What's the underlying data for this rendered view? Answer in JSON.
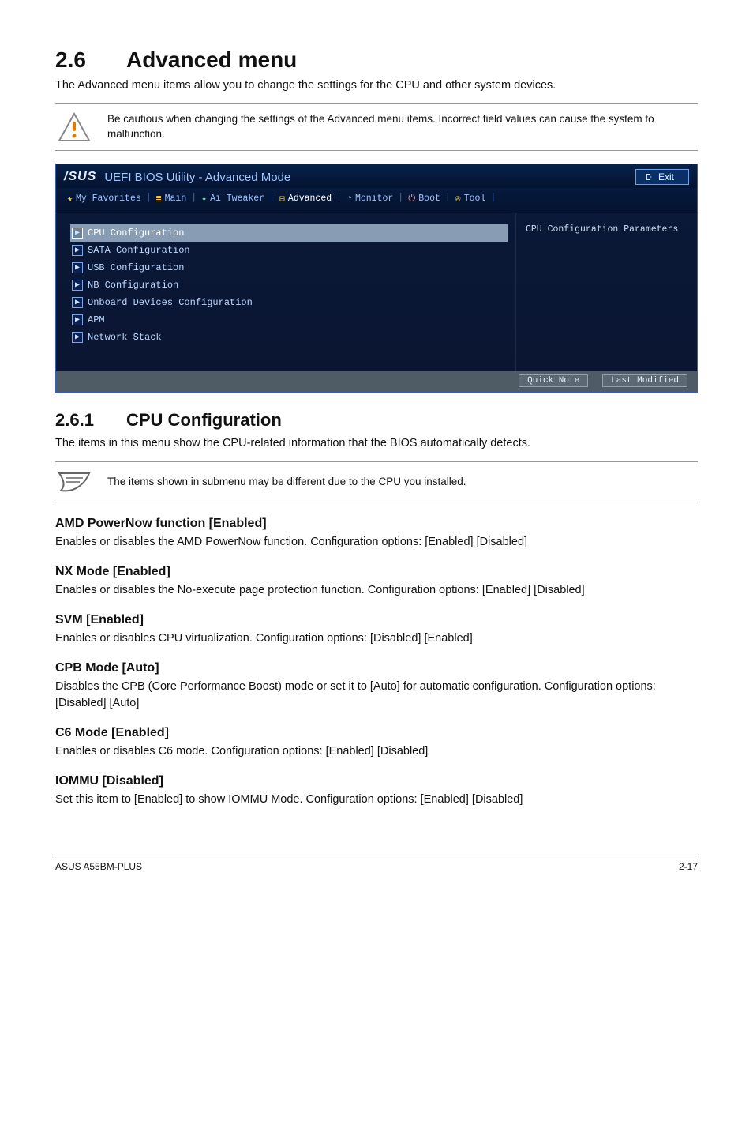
{
  "section": {
    "num": "2.6",
    "title": "Advanced menu",
    "intro": "The Advanced menu items allow you to change the settings for the CPU and other system devices."
  },
  "caution_note": "Be cautious when changing the settings of the Advanced menu items. Incorrect field values can cause the system to malfunction.",
  "bios": {
    "brand": "/SUS",
    "title": "UEFI BIOS Utility - Advanced Mode",
    "exit": "Exit",
    "tabs": {
      "fav": "My Favorites",
      "main": "Main",
      "tweaker": "Ai Tweaker",
      "advanced": "Advanced",
      "monitor": "Monitor",
      "boot": "Boot",
      "tool": "Tool"
    },
    "items": [
      "CPU Configuration",
      "SATA Configuration",
      "USB Configuration",
      "NB Configuration",
      "Onboard Devices Configuration",
      "APM",
      "Network Stack"
    ],
    "right_hint": "CPU Configuration Parameters",
    "footer": {
      "quick": "Quick Note",
      "last": "Last Modified"
    }
  },
  "subsection": {
    "num": "2.6.1",
    "title": "CPU Configuration",
    "intro": "The items in this menu show the CPU-related information that the BIOS automatically detects."
  },
  "info_note": "The items shown in submenu may be different due to the CPU you installed.",
  "settings": [
    {
      "heading": "AMD PowerNow function [Enabled]",
      "body": "Enables or disables the AMD PowerNow function. Configuration options: [Enabled] [Disabled]"
    },
    {
      "heading": "NX Mode [Enabled]",
      "body": "Enables or disables the No-execute page protection function. Configuration options: [Enabled] [Disabled]"
    },
    {
      "heading": "SVM [Enabled]",
      "body": "Enables or disables CPU virtualization. Configuration options: [Disabled] [Enabled]"
    },
    {
      "heading": "CPB Mode [Auto]",
      "body": "Disables the CPB (Core Performance Boost) mode or set it to [Auto] for automatic configuration. Configuration options: [Disabled] [Auto]"
    },
    {
      "heading": "C6 Mode [Enabled]",
      "body": "Enables or disables C6 mode. Configuration options: [Enabled] [Disabled]"
    },
    {
      "heading": "IOMMU [Disabled]",
      "body": "Set this item to [Enabled] to show IOMMU Mode. Configuration options: [Enabled] [Disabled]"
    }
  ],
  "footer": {
    "left": "ASUS A55BM-PLUS",
    "right": "2-17"
  }
}
